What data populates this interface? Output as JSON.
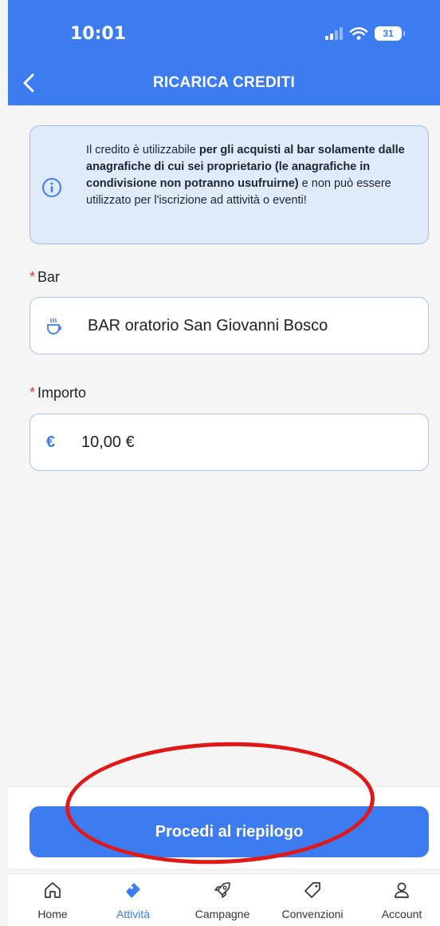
{
  "status_bar": {
    "time": "10:01",
    "battery": "31"
  },
  "header": {
    "title": "RICARICA CREDITI"
  },
  "info": {
    "part1": "Il credito è utilizzabile ",
    "bold": "per gli acquisti al bar solamente dalle anagrafiche di cui sei proprietario (le anagrafiche in condivisione non potranno usufruirne)",
    "part2": " e non può essere utilizzato per l'iscrizione ad attività o eventi!"
  },
  "form": {
    "bar_label": "Bar",
    "bar_value": "BAR oratorio San Giovanni Bosco",
    "importo_label": "Importo",
    "currency_symbol": "€",
    "importo_value": "10,00 €",
    "required_mark": "*"
  },
  "proceed_button": "Procedi al riepilogo",
  "tabs": [
    {
      "label": "Home",
      "icon": "home-icon"
    },
    {
      "label": "Attività",
      "icon": "ticket-icon",
      "active": true
    },
    {
      "label": "Campagne",
      "icon": "rocket-icon"
    },
    {
      "label": "Convenzioni",
      "icon": "tag-icon"
    },
    {
      "label": "Account",
      "icon": "user-icon"
    }
  ],
  "colors": {
    "primary": "#3d7cf0",
    "highlight": "#e11818",
    "required": "#e33b3b"
  }
}
